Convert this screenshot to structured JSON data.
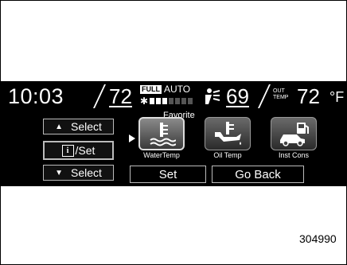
{
  "status": {
    "time": "10:03",
    "driver_temp": "72",
    "fan_mode_badge": "FULL",
    "fan_auto": "AUTO",
    "fan_levels_total": 7,
    "fan_level_on": 3,
    "passenger_temp": "69",
    "outside_label_line1": "OUT",
    "outside_label_line2": "TEMP",
    "outside_temp": "72",
    "outside_unit": "°F"
  },
  "favorite_label": "Favorite",
  "left_buttons": {
    "up_label": "Select",
    "set_label": "/Set",
    "info_glyph": "i",
    "down_label": "Select"
  },
  "tiles": [
    {
      "label": "WaterTemp",
      "icon": "water-temp-icon",
      "selected": true
    },
    {
      "label": "Oil Temp",
      "icon": "oil-temp-icon",
      "selected": false
    },
    {
      "label": "Inst Cons",
      "icon": "instant-consumption-icon",
      "selected": false
    }
  ],
  "bottom_buttons": {
    "set_label": "Set",
    "back_label": "Go Back"
  },
  "figure_code": "304990"
}
